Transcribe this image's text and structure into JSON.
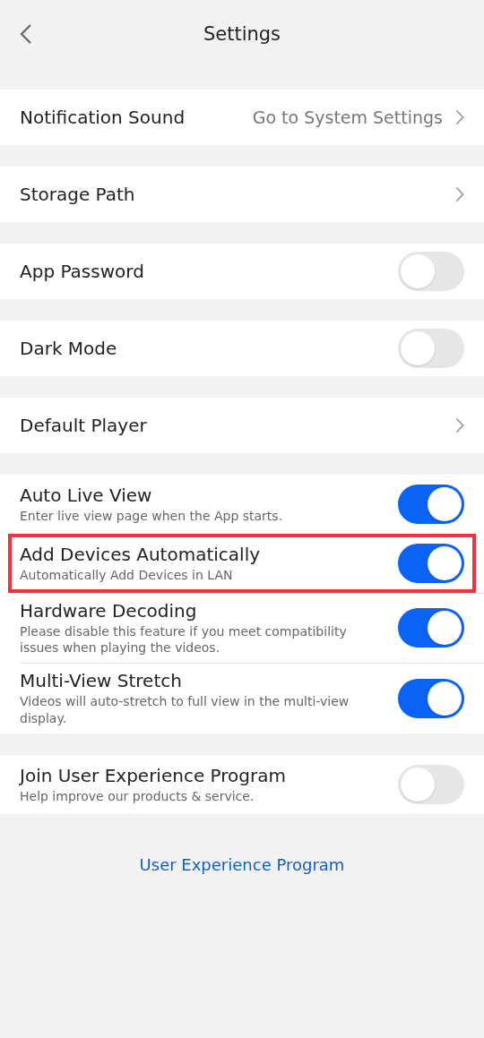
{
  "header": {
    "title": "Settings"
  },
  "sections": [
    {
      "items": [
        {
          "kind": "link",
          "label": "Notification Sound",
          "value": "Go to System Settings"
        }
      ]
    },
    {
      "items": [
        {
          "kind": "link",
          "label": "Storage Path"
        }
      ]
    },
    {
      "items": [
        {
          "kind": "toggle",
          "label": "App Password",
          "on": false
        }
      ]
    },
    {
      "items": [
        {
          "kind": "toggle",
          "label": "Dark Mode",
          "on": false
        }
      ]
    },
    {
      "items": [
        {
          "kind": "link",
          "label": "Default Player"
        }
      ]
    },
    {
      "items": [
        {
          "kind": "toggle",
          "label": "Auto Live View",
          "subtitle": "Enter live view page when the App starts.",
          "on": true,
          "highlighted": false
        },
        {
          "kind": "toggle",
          "label": "Add Devices Automatically",
          "subtitle": "Automatically Add Devices in LAN",
          "on": true,
          "highlighted": true
        },
        {
          "kind": "toggle",
          "label": "Hardware Decoding",
          "subtitle": "Please disable this feature if you meet compatibility issues when playing the videos.",
          "on": true,
          "highlighted": false
        },
        {
          "kind": "toggle",
          "label": "Multi-View Stretch",
          "subtitle": "Videos will auto-stretch to full view in the multi-view display.",
          "on": true,
          "highlighted": false
        }
      ]
    },
    {
      "items": [
        {
          "kind": "toggle",
          "label": "Join User Experience Program",
          "subtitle": "Help improve our products & service.",
          "on": false
        }
      ]
    }
  ],
  "footer_link": "User Experience Program"
}
